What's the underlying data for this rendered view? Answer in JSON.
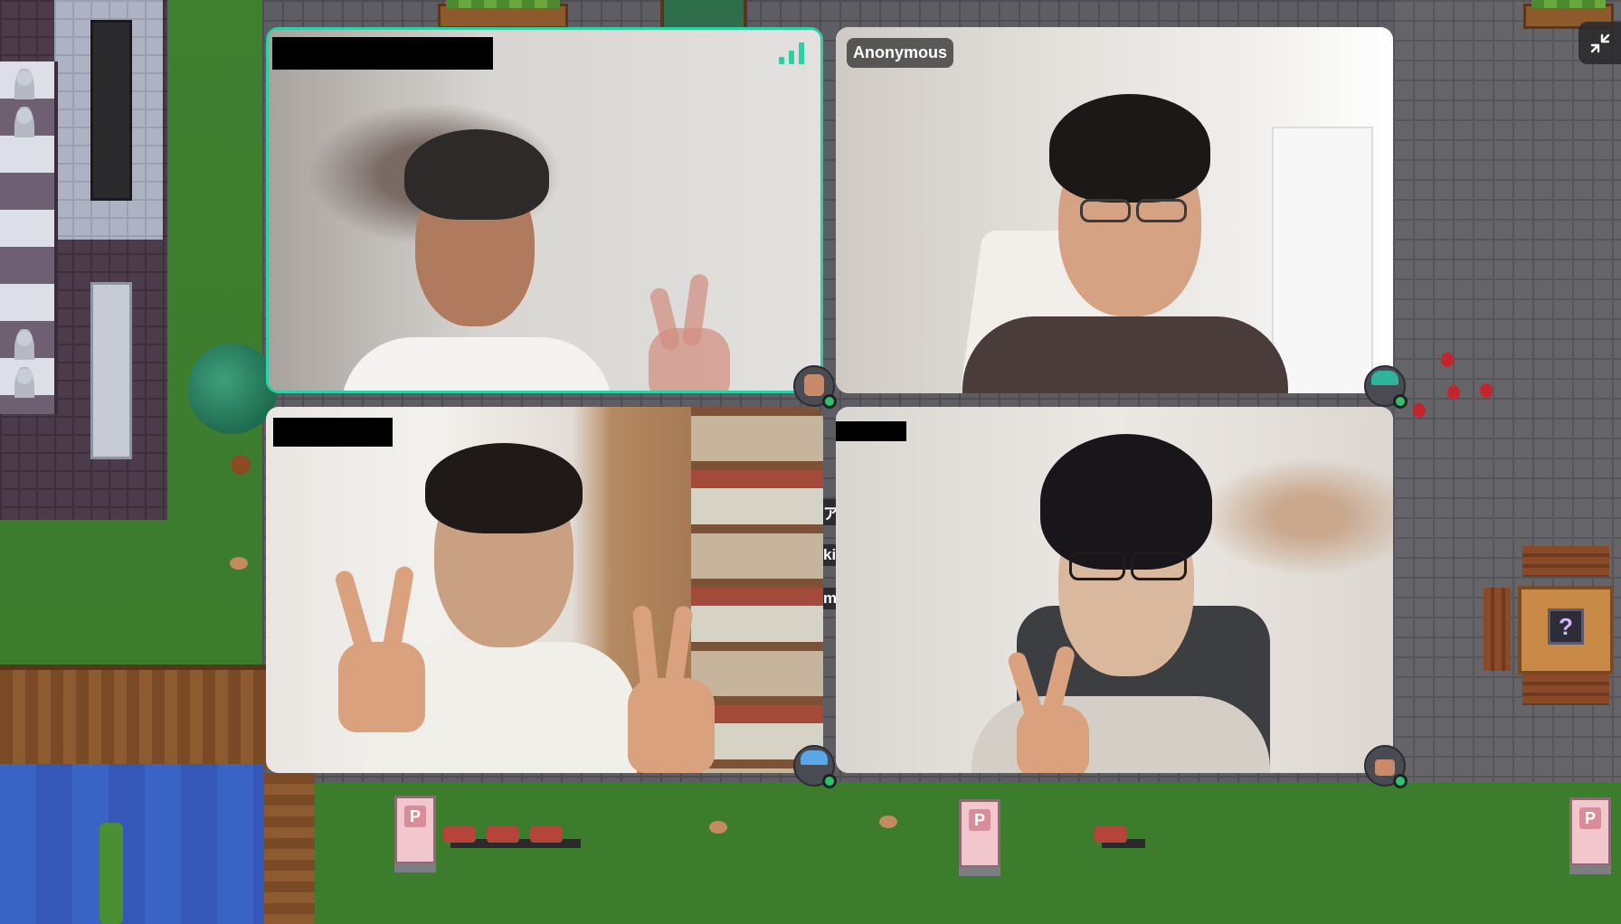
{
  "tiles": {
    "top_right": {
      "name": "Anonymous"
    }
  },
  "map": {
    "sign_letter": "P",
    "mystery_symbol": "?",
    "side_fragments": [
      "ア",
      "ki",
      "m"
    ]
  },
  "colors": {
    "active_speaker_border": "#2ad1a4",
    "status_online": "#2bc46b",
    "label_background": "#282828"
  },
  "icons": {
    "minimize": "minimize-arrows-icon",
    "signal": "signal-strength-icon",
    "status": "online-status-dot"
  }
}
